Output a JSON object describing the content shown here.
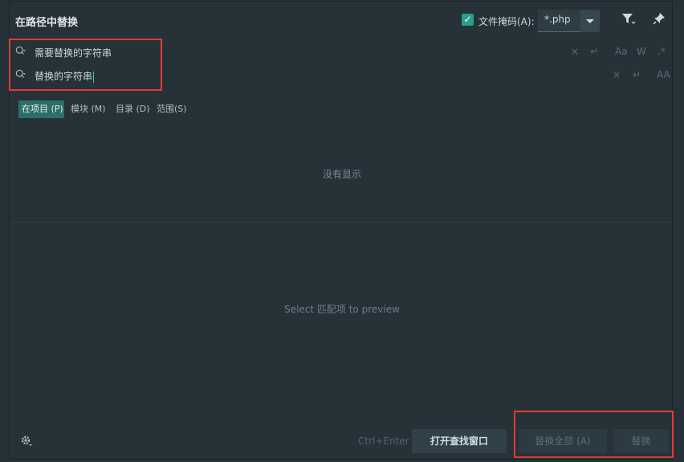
{
  "dialog": {
    "title": "在路径中替换"
  },
  "header": {
    "file_mask_label": "文件掩码(A):",
    "file_mask_value": "*.php",
    "file_mask_checked": true
  },
  "search": {
    "find_value": "需要替换的字符串",
    "replace_value": "替换的字符串",
    "find_options": [
      "×",
      "↵",
      "Aa",
      "W",
      ".*"
    ],
    "replace_options": [
      "×",
      "↵",
      "AA"
    ]
  },
  "scopes": [
    {
      "label": "在项目 (P)",
      "active": true
    },
    {
      "label": "模块 (M)",
      "active": false
    },
    {
      "label": "目录 (D)",
      "active": false
    },
    {
      "label": "范围(S)",
      "active": false
    }
  ],
  "results": {
    "empty_message": "没有显示",
    "preview_message": "Select 匹配项 to preview"
  },
  "footer": {
    "shortcut_hint": "Ctrl+Enter",
    "open_find_window": "打开查找窗口",
    "replace_all": "替换全部 (A)",
    "replace": "替换"
  },
  "colors": {
    "background": "#263238",
    "accent": "#2a9d8f",
    "annotation": "#e53935"
  }
}
